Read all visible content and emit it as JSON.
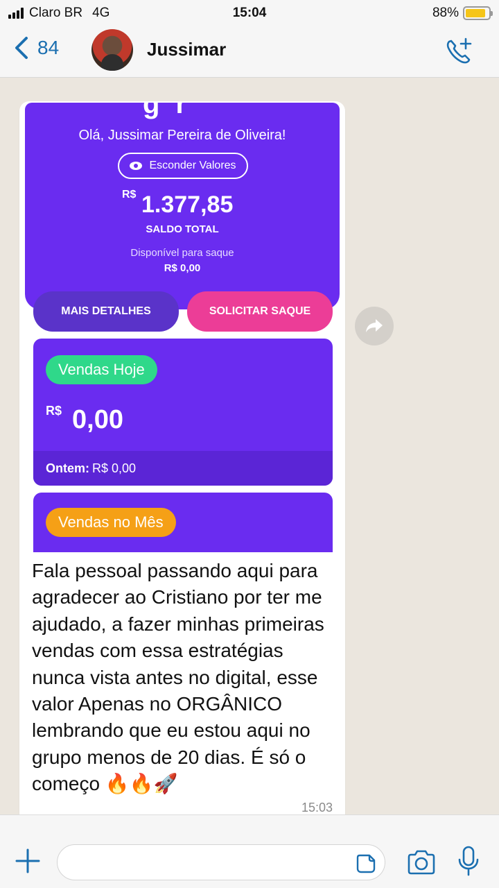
{
  "status_bar": {
    "carrier": "Claro BR",
    "network": "4G",
    "time": "15:04",
    "battery": "88%",
    "battery_level": 0.88,
    "battery_color": "#f5c518"
  },
  "header": {
    "back_count": "84",
    "contact_name": "Jussimar",
    "back_icon": "chevron-left-icon",
    "call_icon": "add-call-icon",
    "accent_color": "#1b6fb0"
  },
  "screenshot": {
    "greeting": "Olá, Jussimar Pereira de Oliveira!",
    "hide_values_label": "Esconder Valores",
    "currency": "R$",
    "balance": "1.377,85",
    "balance_label": "SALDO TOTAL",
    "available_label": "Disponível para saque",
    "available_value": "R$ 0,00",
    "details_button": "MAIS DETALHES",
    "withdraw_button": "SOLICITAR SAQUE",
    "today_label": "Vendas Hoje",
    "today_currency": "R$",
    "today_value": "0,00",
    "yesterday_label": "Ontem:",
    "yesterday_value": "R$ 0,00",
    "month_label": "Vendas no Mês",
    "primary_color": "#6a2cf0",
    "pink_color": "#ec3d97",
    "green_color": "#2fd88a",
    "orange_color": "#f5a016"
  },
  "message": {
    "text": "Fala pessoal passando aqui para agradecer ao Cristiano por ter me ajudado, a fazer minhas primeiras vendas com essa estratégias nunca vista antes no digital, esse valor Apenas no ORGÂNICO lembrando que eu estou aqui no grupo menos de 20 dias. É só o começo 🔥🔥🚀",
    "time": "15:03"
  },
  "input_bar": {
    "icons": [
      "plus-icon",
      "sticker-icon",
      "camera-icon",
      "microphone-icon"
    ]
  }
}
